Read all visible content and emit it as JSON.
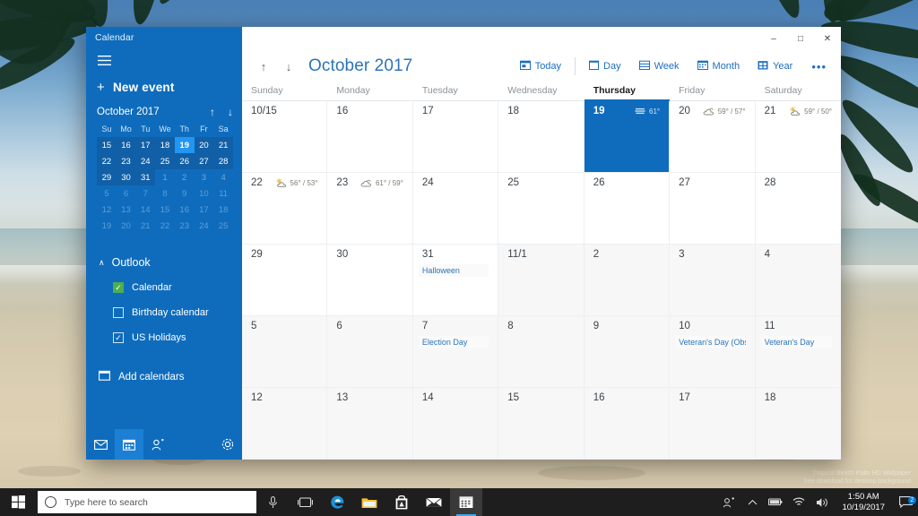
{
  "wallpaper": {
    "watermark_line1": "Tropical Beach Palm HD Wallpaper",
    "watermark_line2": "free download for desktop background"
  },
  "window": {
    "app_title": "Calendar",
    "controls": {
      "minimize": "–",
      "maximize": "□",
      "close": "✕"
    }
  },
  "nav": {
    "new_event": "New event",
    "new_event_plus": "+",
    "mini_calendar": {
      "title": "October 2017",
      "prev_arrow": "↑",
      "next_arrow": "↓",
      "weekdays": [
        "Su",
        "Mo",
        "Tu",
        "We",
        "Th",
        "Fr",
        "Sa"
      ],
      "weeks": [
        [
          {
            "n": "15",
            "s": "range"
          },
          {
            "n": "16",
            "s": "range"
          },
          {
            "n": "17",
            "s": "range"
          },
          {
            "n": "18",
            "s": "range"
          },
          {
            "n": "19",
            "s": "today"
          },
          {
            "n": "20",
            "s": "range"
          },
          {
            "n": "21",
            "s": "range"
          }
        ],
        [
          {
            "n": "22",
            "s": "range"
          },
          {
            "n": "23",
            "s": "range"
          },
          {
            "n": "24",
            "s": "range"
          },
          {
            "n": "25",
            "s": "range"
          },
          {
            "n": "26",
            "s": "range"
          },
          {
            "n": "27",
            "s": "range"
          },
          {
            "n": "28",
            "s": "range"
          }
        ],
        [
          {
            "n": "29",
            "s": "range"
          },
          {
            "n": "30",
            "s": "range"
          },
          {
            "n": "31",
            "s": "range"
          },
          {
            "n": "1",
            "s": "out"
          },
          {
            "n": "2",
            "s": "out"
          },
          {
            "n": "3",
            "s": "out"
          },
          {
            "n": "4",
            "s": "out"
          }
        ],
        [
          {
            "n": "5",
            "s": "dim"
          },
          {
            "n": "6",
            "s": "dim"
          },
          {
            "n": "7",
            "s": "dim"
          },
          {
            "n": "8",
            "s": "dim"
          },
          {
            "n": "9",
            "s": "dim"
          },
          {
            "n": "10",
            "s": "dim"
          },
          {
            "n": "11",
            "s": "dim"
          }
        ],
        [
          {
            "n": "12",
            "s": "dim"
          },
          {
            "n": "13",
            "s": "dim"
          },
          {
            "n": "14",
            "s": "dim"
          },
          {
            "n": "15",
            "s": "dim"
          },
          {
            "n": "16",
            "s": "dim"
          },
          {
            "n": "17",
            "s": "dim"
          },
          {
            "n": "18",
            "s": "dim"
          }
        ],
        [
          {
            "n": "19",
            "s": "dim"
          },
          {
            "n": "20",
            "s": "dim"
          },
          {
            "n": "21",
            "s": "dim"
          },
          {
            "n": "22",
            "s": "dim"
          },
          {
            "n": "23",
            "s": "dim"
          },
          {
            "n": "24",
            "s": "dim"
          },
          {
            "n": "25",
            "s": "dim"
          }
        ]
      ]
    },
    "group": {
      "label": "Outlook",
      "chevron": "∧"
    },
    "calendars": [
      {
        "label": "Calendar",
        "checked": true,
        "color": "#4caf50"
      },
      {
        "label": "Birthday calendar",
        "checked": false,
        "color": ""
      },
      {
        "label": "US Holidays",
        "checked": true,
        "color": ""
      }
    ],
    "add_calendars": "Add calendars",
    "footer_icons": [
      "mail-icon",
      "calendar-icon",
      "people-icon",
      "settings-icon"
    ]
  },
  "toolbar": {
    "prev_arrow": "↑",
    "next_arrow": "↓",
    "month_title": "October 2017",
    "buttons": [
      {
        "label": "Today",
        "name": "today"
      },
      {
        "label": "Day",
        "name": "day"
      },
      {
        "label": "Week",
        "name": "week"
      },
      {
        "label": "Month",
        "name": "month"
      },
      {
        "label": "Year",
        "name": "year"
      }
    ],
    "overflow": "•••"
  },
  "grid": {
    "weekdays": [
      "Sunday",
      "Monday",
      "Tuesday",
      "Wednesday",
      "Thursday",
      "Friday",
      "Saturday"
    ],
    "current_weekday": "Thursday",
    "days": [
      {
        "num": "10/15",
        "state": "normal",
        "weather": null,
        "icon": null,
        "events": []
      },
      {
        "num": "16",
        "state": "normal",
        "weather": null,
        "icon": null,
        "events": []
      },
      {
        "num": "17",
        "state": "normal",
        "weather": null,
        "icon": null,
        "events": []
      },
      {
        "num": "18",
        "state": "normal",
        "weather": null,
        "icon": null,
        "events": []
      },
      {
        "num": "19",
        "state": "selected",
        "weather": "61°",
        "icon": "fog",
        "events": []
      },
      {
        "num": "20",
        "state": "normal",
        "weather": "59° / 57°",
        "icon": "cloudy",
        "events": []
      },
      {
        "num": "21",
        "state": "normal",
        "weather": "59° / 50°",
        "icon": "partly-sunny",
        "events": []
      },
      {
        "num": "22",
        "state": "normal",
        "weather": "56° / 53°",
        "icon": "partly-sunny",
        "events": []
      },
      {
        "num": "23",
        "state": "normal",
        "weather": "61° / 59°",
        "icon": "cloudy",
        "events": []
      },
      {
        "num": "24",
        "state": "normal",
        "weather": null,
        "icon": null,
        "events": []
      },
      {
        "num": "25",
        "state": "normal",
        "weather": null,
        "icon": null,
        "events": []
      },
      {
        "num": "26",
        "state": "normal",
        "weather": null,
        "icon": null,
        "events": []
      },
      {
        "num": "27",
        "state": "normal",
        "weather": null,
        "icon": null,
        "events": []
      },
      {
        "num": "28",
        "state": "normal",
        "weather": null,
        "icon": null,
        "events": []
      },
      {
        "num": "29",
        "state": "normal",
        "weather": null,
        "icon": null,
        "events": []
      },
      {
        "num": "30",
        "state": "normal",
        "weather": null,
        "icon": null,
        "events": []
      },
      {
        "num": "31",
        "state": "normal",
        "weather": null,
        "icon": null,
        "events": [
          "Halloween"
        ]
      },
      {
        "num": "11/1",
        "state": "other",
        "weather": null,
        "icon": null,
        "events": []
      },
      {
        "num": "2",
        "state": "other",
        "weather": null,
        "icon": null,
        "events": []
      },
      {
        "num": "3",
        "state": "other",
        "weather": null,
        "icon": null,
        "events": []
      },
      {
        "num": "4",
        "state": "other",
        "weather": null,
        "icon": null,
        "events": []
      },
      {
        "num": "5",
        "state": "other",
        "weather": null,
        "icon": null,
        "events": []
      },
      {
        "num": "6",
        "state": "other",
        "weather": null,
        "icon": null,
        "events": []
      },
      {
        "num": "7",
        "state": "other",
        "weather": null,
        "icon": null,
        "events": [
          "Election Day"
        ]
      },
      {
        "num": "8",
        "state": "other",
        "weather": null,
        "icon": null,
        "events": []
      },
      {
        "num": "9",
        "state": "other",
        "weather": null,
        "icon": null,
        "events": []
      },
      {
        "num": "10",
        "state": "other",
        "weather": null,
        "icon": null,
        "events": [
          "Veteran's Day (Observ"
        ]
      },
      {
        "num": "11",
        "state": "other",
        "weather": null,
        "icon": null,
        "events": [
          "Veteran's Day"
        ]
      },
      {
        "num": "12",
        "state": "other",
        "weather": null,
        "icon": null,
        "events": []
      },
      {
        "num": "13",
        "state": "other",
        "weather": null,
        "icon": null,
        "events": []
      },
      {
        "num": "14",
        "state": "other",
        "weather": null,
        "icon": null,
        "events": []
      },
      {
        "num": "15",
        "state": "other",
        "weather": null,
        "icon": null,
        "events": []
      },
      {
        "num": "16",
        "state": "other",
        "weather": null,
        "icon": null,
        "events": []
      },
      {
        "num": "17",
        "state": "other",
        "weather": null,
        "icon": null,
        "events": []
      },
      {
        "num": "18",
        "state": "other",
        "weather": null,
        "icon": null,
        "events": []
      }
    ]
  },
  "taskbar": {
    "search_placeholder": "Type here to search",
    "clock_time": "1:50 AM",
    "clock_date": "10/19/2017",
    "notification_count": "2",
    "apps": [
      "task-view-icon",
      "edge-icon",
      "file-explorer-icon",
      "store-icon",
      "mail-icon",
      "calendar-icon"
    ],
    "tray": [
      "people-icon",
      "show-hidden-icons-icon",
      "battery-icon",
      "wifi-icon",
      "volume-icon"
    ]
  },
  "colors": {
    "accent": "#0f6cbd",
    "link": "#2a74b8",
    "selected": "#0f6cbd",
    "today_mini": "#2196f3",
    "checkbox_green": "#4caf50"
  }
}
